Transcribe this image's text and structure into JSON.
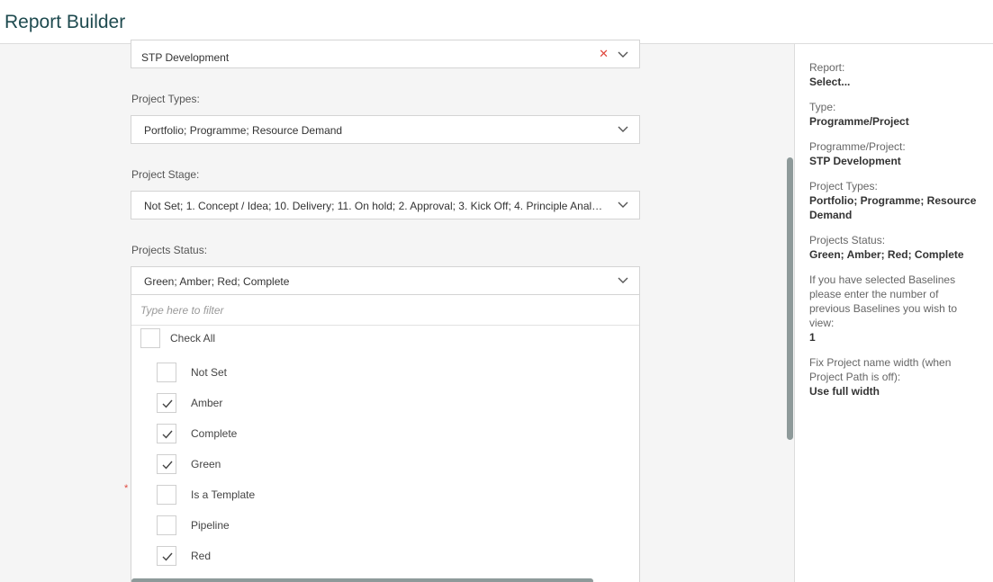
{
  "header": {
    "title": "Report Builder"
  },
  "form": {
    "programme": {
      "value": "STP Development"
    },
    "project_types": {
      "label": "Project Types:",
      "value": "Portfolio; Programme; Resource Demand"
    },
    "project_stage": {
      "label": "Project Stage:",
      "value": "Not Set; 1. Concept / Idea; 10. Delivery; 11. On hold; 2. Approval; 3. Kick Off; 4. Principle Analysi..."
    },
    "projects_status": {
      "label": "Projects Status:",
      "value": "Green; Amber; Red; Complete"
    },
    "required_marker": "*"
  },
  "dropdown": {
    "filter_placeholder": "Type here to filter",
    "check_all": "Check All",
    "options": [
      {
        "label": "Not Set",
        "checked": false
      },
      {
        "label": "Amber",
        "checked": true
      },
      {
        "label": "Complete",
        "checked": true
      },
      {
        "label": "Green",
        "checked": true
      },
      {
        "label": "Is a Template",
        "checked": false
      },
      {
        "label": "Pipeline",
        "checked": false
      },
      {
        "label": "Red",
        "checked": true
      }
    ]
  },
  "summary": {
    "report_label": "Report:",
    "report_value": "Select...",
    "type_label": "Type:",
    "type_value": "Programme/Project",
    "programme_label": "Programme/Project:",
    "programme_value": "STP Development",
    "ptypes_label": "Project Types:",
    "ptypes_value": "Portfolio; Programme; Resource Demand",
    "pstatus_label": "Projects Status:",
    "pstatus_value": "Green; Amber; Red; Complete",
    "baselines_label": "If you have selected Baselines please enter the number of previous Baselines you wish to view:",
    "baselines_value": "1",
    "fixwidth_label": "Fix Project name width (when Project Path is off):",
    "fixwidth_value": "Use full width"
  },
  "colors": {
    "accent": "#1e4a4f",
    "clear": "#e0483e",
    "scroll": "#8e9a9a"
  }
}
